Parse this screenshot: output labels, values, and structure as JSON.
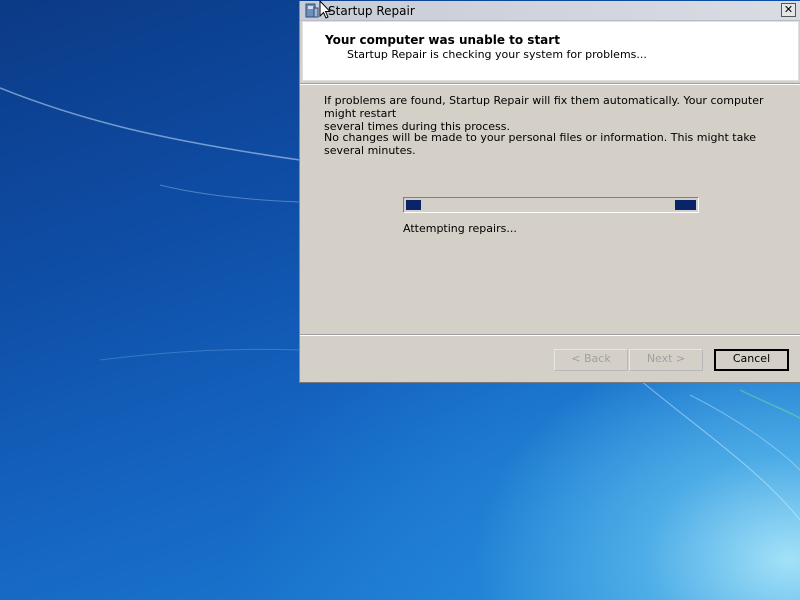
{
  "window": {
    "title": "Startup Repair",
    "close_glyph": "✕"
  },
  "header": {
    "title": "Your computer was unable to start",
    "subtitle": "Startup Repair is checking your system for problems..."
  },
  "body": {
    "paragraph1_line1": "If problems are found, Startup Repair will fix them automatically. Your computer might restart",
    "paragraph1_line2": "several times during this process.",
    "paragraph2": "No changes will be made to your personal files or information. This might take several minutes."
  },
  "progress": {
    "status_text": "Attempting repairs...",
    "style": "marquee",
    "color": "#0a246a"
  },
  "buttons": {
    "back_label": "< Back",
    "next_label": "Next >",
    "cancel_label": "Cancel"
  },
  "icons": {
    "app": "startup-repair-icon",
    "close": "close-icon",
    "cursor": "mouse-pointer-icon"
  },
  "colors": {
    "dialog_bg": "#d4d0c8",
    "header_bg": "#ffffff",
    "desktop_accent": "#1464c0"
  }
}
